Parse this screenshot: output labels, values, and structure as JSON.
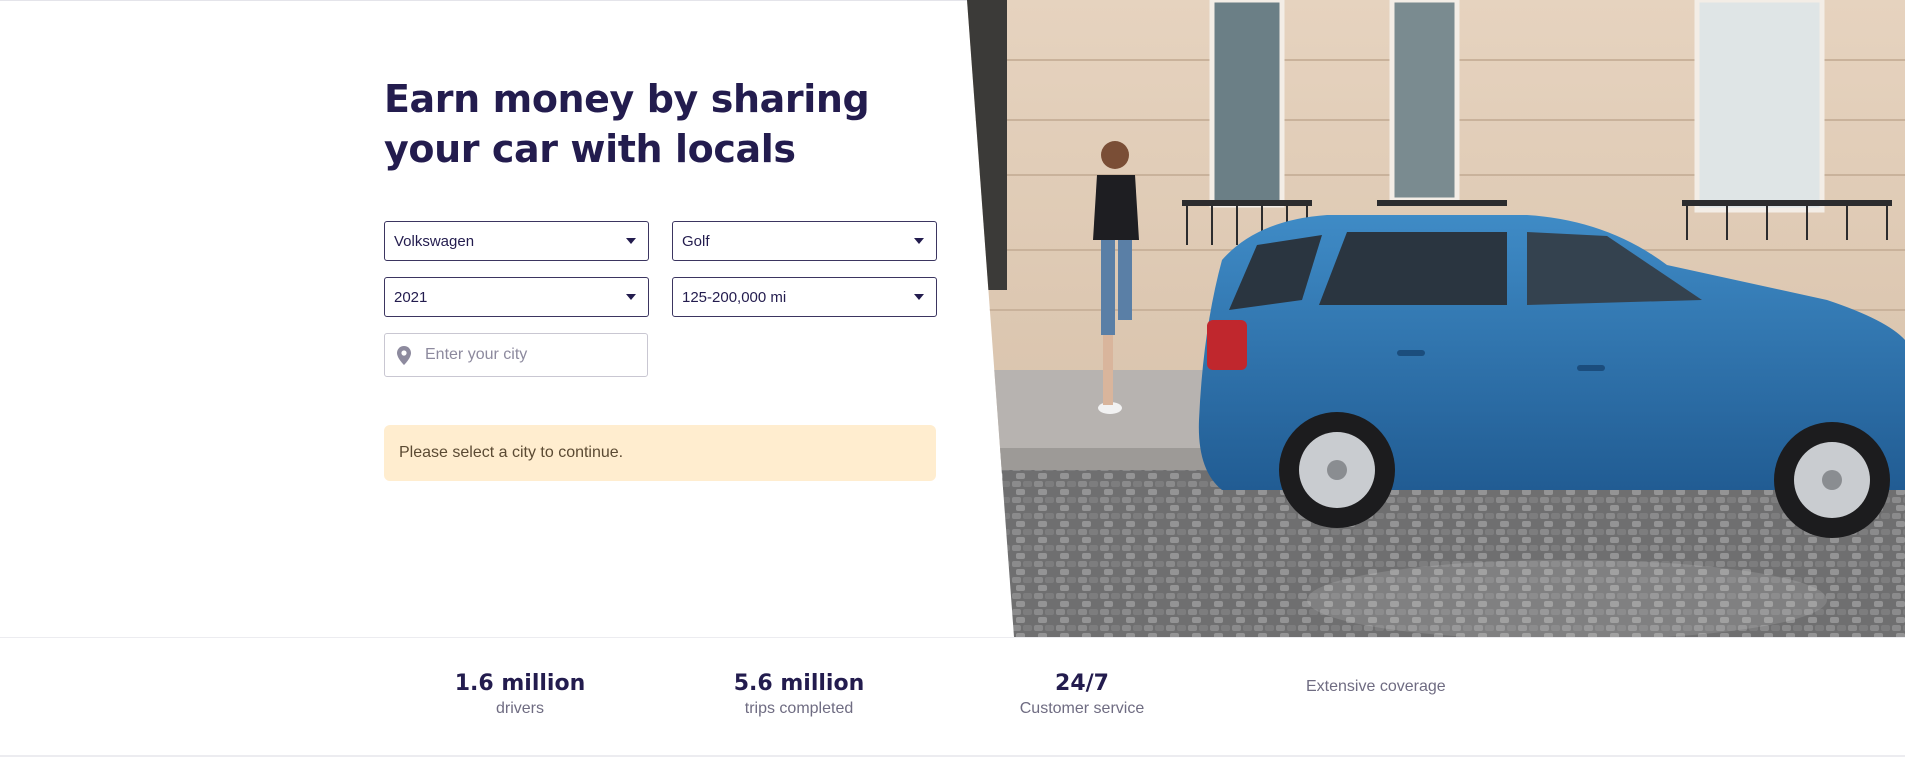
{
  "hero": {
    "title": "Earn money by sharing your car with locals",
    "make": "Volkswagen",
    "model": "Golf",
    "year": "2021",
    "mileage": "125-200,000 mi",
    "city_placeholder": "Enter your city",
    "city_value": "",
    "alert": "Please select a city to continue."
  },
  "icons": {
    "dropdown": "chevron-down-icon",
    "location": "map-pin-icon"
  },
  "stats": {
    "drivers_value": "1.6 million",
    "drivers_label": "drivers",
    "trips_value": "5.6 million",
    "trips_label": "trips completed",
    "service_value": "24/7",
    "service_label": "Customer service",
    "coverage_label": "Extensive coverage"
  },
  "colors": {
    "text_primary": "#231c4e",
    "alert_bg": "#ffedcf",
    "car_blue": "#2f77b3"
  }
}
